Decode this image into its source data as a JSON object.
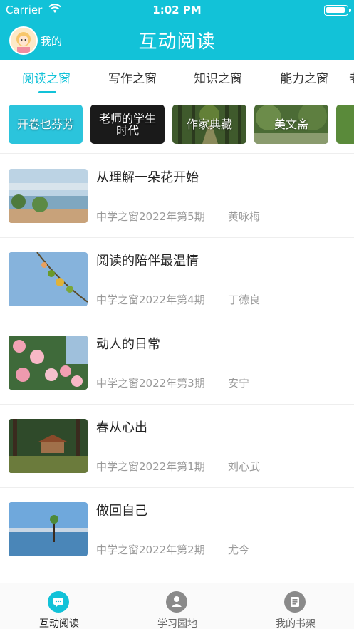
{
  "status_bar": {
    "carrier": "Carrier",
    "time": "1:02 PM"
  },
  "header": {
    "me_label": "我的",
    "title": "互动阅读"
  },
  "tabs": [
    {
      "label": "阅读之窗",
      "active": true
    },
    {
      "label": "写作之窗",
      "active": false
    },
    {
      "label": "知识之窗",
      "active": false
    },
    {
      "label": "能力之窗",
      "active": false
    },
    {
      "label": "老",
      "active": false
    }
  ],
  "columns": [
    {
      "label": "开卷也芬芳"
    },
    {
      "label_line1": "老师的学生",
      "label_line2": "时代"
    },
    {
      "label": "作家典藏"
    },
    {
      "label": "美文斋"
    },
    {
      "label": ""
    }
  ],
  "articles": [
    {
      "title": "从理解一朵花开始",
      "source": "中学之窗2022年第5期",
      "author": "黄咏梅"
    },
    {
      "title": "阅读的陪伴最温情",
      "source": "中学之窗2022年第4期",
      "author": "丁德良"
    },
    {
      "title": "动人的日常",
      "source": "中学之窗2022年第3期",
      "author": "安宁"
    },
    {
      "title": "春从心出",
      "source": "中学之窗2022年第1期",
      "author": "刘心武"
    },
    {
      "title": "做回自己",
      "source": "中学之窗2022年第2期",
      "author": "尤今"
    }
  ],
  "bottom_nav": [
    {
      "label": "互动阅读",
      "icon": "chat-icon",
      "active": true
    },
    {
      "label": "学习园地",
      "icon": "person-icon",
      "active": false
    },
    {
      "label": "我的书架",
      "icon": "book-icon",
      "active": false
    }
  ],
  "colors": {
    "accent": "#12c2d8"
  }
}
